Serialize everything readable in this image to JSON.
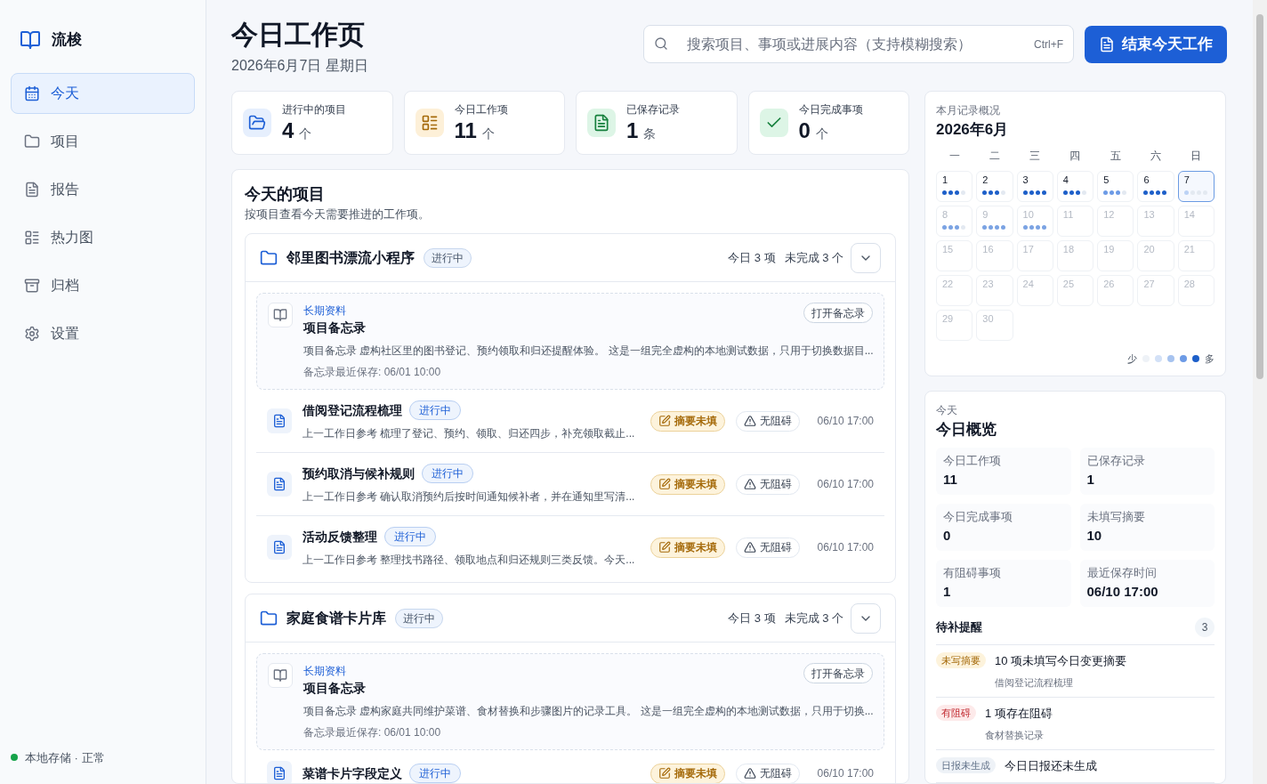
{
  "sidebar": {
    "brand": "流梭",
    "items": [
      {
        "label": "今天",
        "selected": true
      },
      {
        "label": "项目",
        "selected": false
      },
      {
        "label": "报告",
        "selected": false
      },
      {
        "label": "热力图",
        "selected": false
      },
      {
        "label": "归档",
        "selected": false
      },
      {
        "label": "设置",
        "selected": false
      }
    ],
    "status": {
      "text": "本地存储 · 正常",
      "color": "#16a34a"
    }
  },
  "header": {
    "title": "今日工作页",
    "date": "2026年6月7日 星期日",
    "search": {
      "placeholder": "搜索项目、事项或进展内容（支持模糊搜索）",
      "shortcut": "Ctrl+F"
    },
    "primary_button": "结束今天工作"
  },
  "stats": [
    {
      "kind": "projects",
      "label": "进行中的项目",
      "value": "4",
      "unit": "个"
    },
    {
      "kind": "items",
      "label": "今日工作项",
      "value": "11",
      "unit": "个"
    },
    {
      "kind": "records",
      "label": "已保存记录",
      "value": "1",
      "unit": "条"
    },
    {
      "kind": "done",
      "label": "今日完成事项",
      "value": "0",
      "unit": "个"
    }
  ],
  "projects_section": {
    "title": "今天的项目",
    "subtitle": "按项目查看今天需要推进的工作项。",
    "projects": [
      {
        "name": "邻里图书漂流小程序",
        "status": "进行中",
        "summary_count": "今日 3 项",
        "summary_open": "未完成 3 个",
        "expanded": true,
        "entries": [
          {
            "kind": "memo",
            "tag": "长期资料",
            "title": "项目备忘录",
            "description": "项目备忘录 虚构社区里的图书登记、预约领取和归还提醒体验。 这是一组完全虚构的本地测试数据，只用于切换数据目...",
            "saved": "备忘录最近保存: 06/01 10:00",
            "action": "打开备忘录"
          },
          {
            "kind": "task",
            "title": "借阅登记流程梳理",
            "status": "进行中",
            "description": "上一工作日参考  梳理了登记、预约、领取、归还四步，补充领取截止...",
            "summary_badge": "摘要未填",
            "block_badge": "无阻碍",
            "time": "06/10 17:00"
          },
          {
            "kind": "task",
            "title": "预约取消与候补规则",
            "status": "进行中",
            "description": "上一工作日参考  确认取消预约后按时间通知候补者，并在通知里写清...",
            "summary_badge": "摘要未填",
            "block_badge": "无阻碍",
            "time": "06/10 17:00"
          },
          {
            "kind": "task",
            "title": "活动反馈整理",
            "status": "进行中",
            "description": "上一工作日参考  整理找书路径、领取地点和归还规则三类反馈。今天...",
            "summary_badge": "摘要未填",
            "block_badge": "无阻碍",
            "time": "06/10 17:00"
          }
        ]
      },
      {
        "name": "家庭食谱卡片库",
        "status": "进行中",
        "summary_count": "今日 3 项",
        "summary_open": "未完成 3 个",
        "expanded": true,
        "entries": [
          {
            "kind": "memo",
            "tag": "长期资料",
            "title": "项目备忘录",
            "description": "项目备忘录 虚构家庭共同维护菜谱、食材替换和步骤图片的记录工具。 这是一组完全虚构的本地测试数据，只用于切换...",
            "saved": "备忘录最近保存: 06/01 10:00",
            "action": "打开备忘录"
          },
          {
            "kind": "task",
            "title": "菜谱卡片字段定义",
            "status": "进行中",
            "summary_badge": "摘要未填",
            "block_badge": "无阻碍",
            "time": "06/10 17:00"
          }
        ]
      }
    ]
  },
  "calendar": {
    "caption": "本月记录概况",
    "month": "2026年6月",
    "weekdays": [
      "一",
      "二",
      "三",
      "四",
      "五",
      "六",
      "日"
    ],
    "days": [
      {
        "label": "1",
        "color": "#1d5fc9",
        "muted": false,
        "selected": false,
        "dots": [
          {
            "filled": true
          },
          {
            "filled": true
          },
          {
            "filled": true
          },
          {
            "filled": false
          }
        ]
      },
      {
        "label": "2",
        "color": "#1d5fc9",
        "muted": false,
        "selected": false,
        "dots": [
          {
            "filled": true
          },
          {
            "filled": true
          },
          {
            "filled": true
          },
          {
            "filled": false
          }
        ]
      },
      {
        "label": "3",
        "color": "#1d5fc9",
        "muted": false,
        "selected": false,
        "dots": [
          {
            "filled": true
          },
          {
            "filled": true
          },
          {
            "filled": true
          },
          {
            "filled": true
          }
        ]
      },
      {
        "label": "4",
        "color": "#1d5fc9",
        "muted": false,
        "selected": false,
        "dots": [
          {
            "filled": true
          },
          {
            "filled": true
          },
          {
            "filled": true
          },
          {
            "filled": false
          }
        ]
      },
      {
        "label": "5",
        "color": "#6d9be6",
        "muted": false,
        "selected": false,
        "dots": [
          {
            "filled": true
          },
          {
            "filled": true
          },
          {
            "filled": true
          },
          {
            "filled": false
          }
        ]
      },
      {
        "label": "6",
        "color": "#1d5fc9",
        "muted": false,
        "selected": false,
        "dots": [
          {
            "filled": true
          },
          {
            "filled": true
          },
          {
            "filled": true
          },
          {
            "filled": true
          }
        ]
      },
      {
        "label": "7",
        "color": "#bcd2f5",
        "muted": false,
        "selected": true,
        "dots": [
          {
            "filled": true
          },
          {
            "filled": false
          },
          {
            "filled": false
          },
          {
            "filled": false
          }
        ]
      },
      {
        "label": "8",
        "color": "#7ba3e3",
        "muted": true,
        "selected": false,
        "dots": [
          {
            "filled": true
          },
          {
            "filled": true
          },
          {
            "filled": true
          },
          {
            "filled": false
          }
        ]
      },
      {
        "label": "9",
        "color": "#7ba3e3",
        "muted": true,
        "selected": false,
        "dots": [
          {
            "filled": true
          },
          {
            "filled": true
          },
          {
            "filled": true
          },
          {
            "filled": true
          }
        ]
      },
      {
        "label": "10",
        "color": "#7ba3e3",
        "muted": true,
        "selected": false,
        "dots": [
          {
            "filled": true
          },
          {
            "filled": true
          },
          {
            "filled": true
          },
          {
            "filled": true
          }
        ]
      },
      {
        "label": "11",
        "muted": true,
        "selected": false
      },
      {
        "label": "12",
        "muted": true,
        "selected": false
      },
      {
        "label": "13",
        "muted": true,
        "selected": false
      },
      {
        "label": "14",
        "muted": true,
        "selected": false
      },
      {
        "label": "15",
        "muted": true,
        "selected": false
      },
      {
        "label": "16",
        "muted": true,
        "selected": false
      },
      {
        "label": "17",
        "muted": true,
        "selected": false
      },
      {
        "label": "18",
        "muted": true,
        "selected": false
      },
      {
        "label": "19",
        "muted": true,
        "selected": false
      },
      {
        "label": "20",
        "muted": true,
        "selected": false
      },
      {
        "label": "21",
        "muted": true,
        "selected": false
      },
      {
        "label": "22",
        "muted": true,
        "selected": false
      },
      {
        "label": "23",
        "muted": true,
        "selected": false
      },
      {
        "label": "24",
        "muted": true,
        "selected": false
      },
      {
        "label": "25",
        "muted": true,
        "selected": false
      },
      {
        "label": "26",
        "muted": true,
        "selected": false
      },
      {
        "label": "27",
        "muted": true,
        "selected": false
      },
      {
        "label": "28",
        "muted": true,
        "selected": false
      },
      {
        "label": "29",
        "muted": true,
        "selected": false
      },
      {
        "label": "30",
        "muted": true,
        "selected": false
      }
    ],
    "legend": {
      "low": "少",
      "high": "多",
      "swatches": [
        {
          "color": "#eef2f7"
        },
        {
          "color": "#d3e1f7"
        },
        {
          "color": "#a7c3ef"
        },
        {
          "color": "#6d9be6"
        },
        {
          "color": "#1d5fc9"
        }
      ]
    }
  },
  "overview": {
    "caption": "今天",
    "title": "今日概览",
    "tiles": [
      {
        "label": "今日工作项",
        "value": "11"
      },
      {
        "label": "已保存记录",
        "value": "1"
      },
      {
        "label": "今日完成事项",
        "value": "0"
      },
      {
        "label": "未填写摘要",
        "value": "10"
      },
      {
        "label": "有阻碍事项",
        "value": "1"
      },
      {
        "label": "最近保存时间",
        "value": "06/10 17:00"
      }
    ],
    "reminders": {
      "title": "待补提醒",
      "count": "3",
      "items": [
        {
          "kind": "warning",
          "tag": "未写摘要",
          "text": "10 项未填写今日变更摘要",
          "detail": "借阅登记流程梳理"
        },
        {
          "kind": "danger",
          "tag": "有阻碍",
          "text": "1 项存在阻碍",
          "detail": "食材替换记录"
        },
        {
          "kind": "neutral",
          "tag": "日报未生成",
          "text": "今日日报还未生成"
        }
      ]
    }
  }
}
